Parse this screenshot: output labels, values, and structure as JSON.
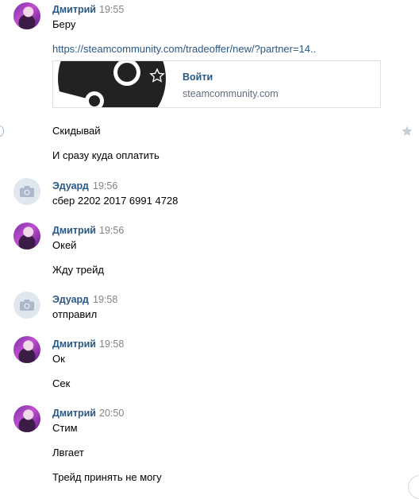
{
  "messages": [
    {
      "author": "Дмитрий",
      "time": "19:55",
      "lines": [
        "Беру"
      ],
      "link": {
        "url": "https://steamcommunity.com/tradeoffer/new/?partner=14..",
        "card_title": "Войти",
        "card_domain": "steamcommunity.com"
      },
      "extra": [
        "Скидывай",
        "И сразу куда оплатить"
      ]
    },
    {
      "author": "Эдуард",
      "time": "19:56",
      "lines": [
        "сбер 2202 2017 6991 4728"
      ]
    },
    {
      "author": "Дмитрий",
      "time": "19:56",
      "lines": [
        "Окей",
        "Жду трейд"
      ]
    },
    {
      "author": "Эдуард",
      "time": "19:58",
      "lines": [
        "отправил"
      ]
    },
    {
      "author": "Дмитрий",
      "time": "19:58",
      "lines": [
        "Ок",
        "Сек"
      ]
    },
    {
      "author": "Дмитрий",
      "time": "20:50",
      "lines": [
        "Стим",
        "Лвгает",
        "Трейд принять не могу"
      ]
    }
  ],
  "icons": {
    "favorite": "star-icon",
    "avatar_placeholder": "camera-icon",
    "steam": "steam-logo-icon"
  }
}
